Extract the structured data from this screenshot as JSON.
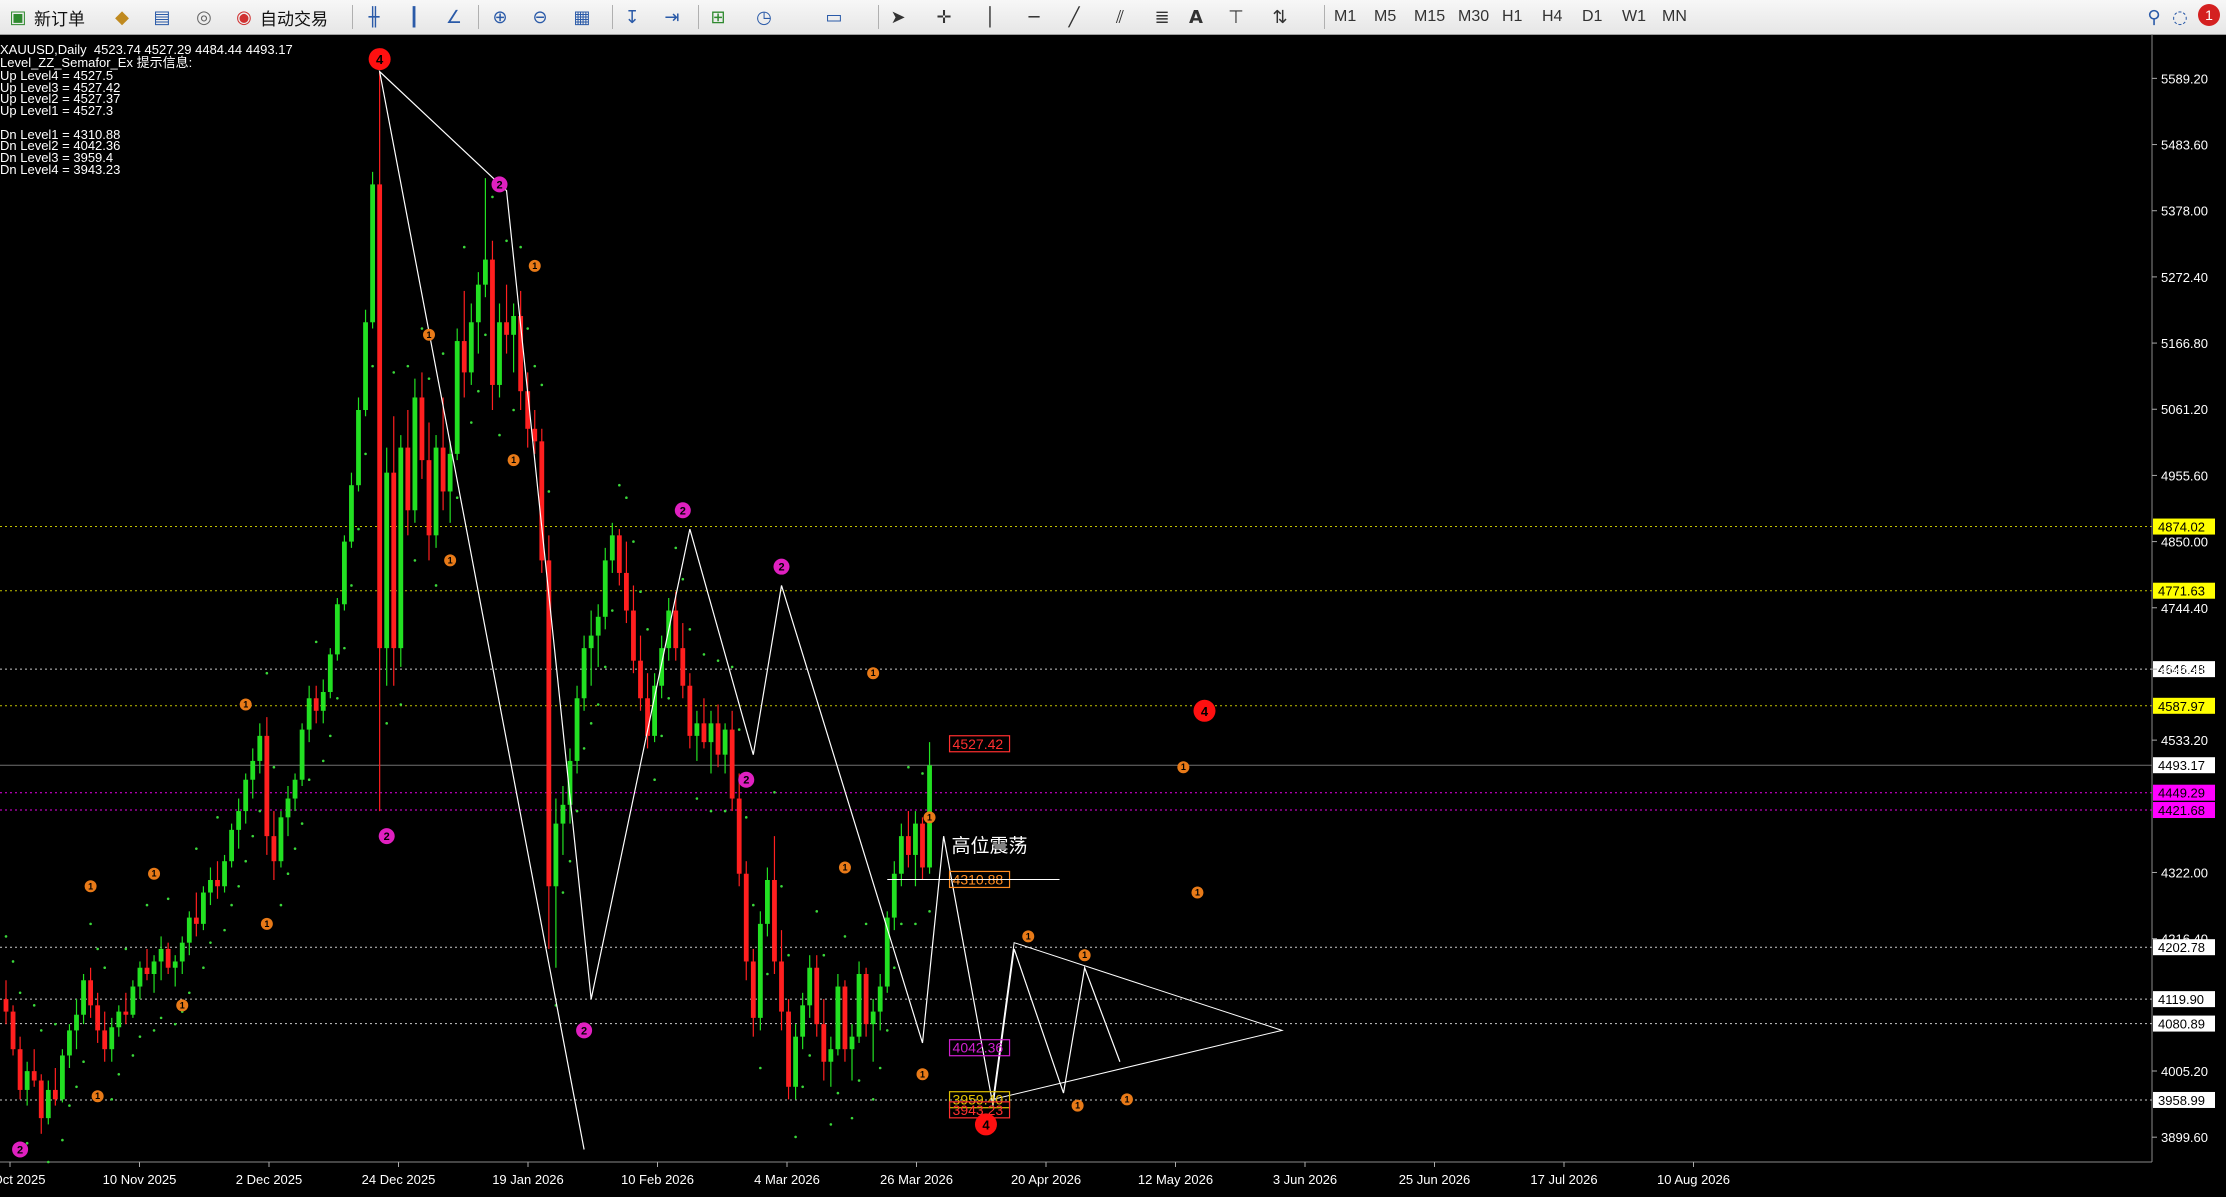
{
  "toolbar": {
    "new_order": "新订单",
    "auto_trading": "自动交易",
    "timeframes": [
      "M1",
      "M5",
      "M15",
      "M30",
      "H1",
      "H4",
      "D1",
      "W1",
      "MN"
    ],
    "notification_count": "1"
  },
  "info": {
    "symbol_line": "XAUUSD,Daily  4523.74 4527.29 4484.44 4493.17",
    "indicator_name": "Level_ZZ_Semafor_Ex 提示信息:",
    "lines": [
      "Up Level4 = 4527.5",
      "Up Level3 = 4527.42",
      "Up Level2 = 4527.37",
      "Up Level1 = 4527.3",
      "",
      "Dn Level1 = 4310.88",
      "Dn Level2 = 4042.36",
      "Dn Level3 = 3959.4",
      "Dn Level4 = 3943.23"
    ]
  },
  "chart_data": {
    "type": "candlestick",
    "symbol": "XAUUSD",
    "timeframe": "Daily",
    "ylim": [
      3860,
      5660
    ],
    "y_ticks": [
      "5589.20",
      "5483.60",
      "5378.00",
      "5272.40",
      "5166.80",
      "5061.20",
      "4955.60",
      "4850.00",
      "4744.40",
      "4646.48",
      "4533.20",
      "4322.00",
      "4216.40",
      "4005.20",
      "3899.60"
    ],
    "x_ticks": [
      "20 Oct 2025",
      "10 Nov 2025",
      "2 Dec 2025",
      "24 Dec 2025",
      "19 Jan 2026",
      "10 Feb 2026",
      "4 Mar 2026",
      "26 Mar 2026",
      "20 Apr 2026",
      "12 May 2026",
      "3 Jun 2026",
      "25 Jun 2026",
      "17 Jul 2026",
      "10 Aug 2026"
    ],
    "candles": [
      [
        4120,
        4150,
        4080,
        4100
      ],
      [
        4100,
        4110,
        4030,
        4040
      ],
      [
        4040,
        4060,
        3960,
        3975
      ],
      [
        3975,
        4020,
        3950,
        4005
      ],
      [
        4005,
        4040,
        3980,
        3990
      ],
      [
        3990,
        4000,
        3905,
        3930
      ],
      [
        3930,
        3990,
        3920,
        3975
      ],
      [
        3975,
        4010,
        3950,
        3960
      ],
      [
        3960,
        4040,
        3955,
        4030
      ],
      [
        4030,
        4080,
        4010,
        4070
      ],
      [
        4070,
        4120,
        4040,
        4095
      ],
      [
        4095,
        4160,
        4080,
        4150
      ],
      [
        4150,
        4170,
        4090,
        4110
      ],
      [
        4110,
        4130,
        4050,
        4070
      ],
      [
        4070,
        4100,
        4020,
        4040
      ],
      [
        4040,
        4090,
        4020,
        4075
      ],
      [
        4075,
        4110,
        4060,
        4100
      ],
      [
        4100,
        4130,
        4080,
        4095
      ],
      [
        4095,
        4150,
        4090,
        4140
      ],
      [
        4140,
        4180,
        4120,
        4170
      ],
      [
        4170,
        4200,
        4150,
        4160
      ],
      [
        4160,
        4190,
        4130,
        4180
      ],
      [
        4180,
        4220,
        4150,
        4200
      ],
      [
        4200,
        4210,
        4160,
        4170
      ],
      [
        4170,
        4190,
        4140,
        4180
      ],
      [
        4180,
        4220,
        4160,
        4210
      ],
      [
        4210,
        4260,
        4190,
        4250
      ],
      [
        4250,
        4290,
        4220,
        4240
      ],
      [
        4240,
        4300,
        4230,
        4290
      ],
      [
        4290,
        4330,
        4270,
        4310
      ],
      [
        4310,
        4340,
        4280,
        4300
      ],
      [
        4300,
        4350,
        4290,
        4340
      ],
      [
        4340,
        4400,
        4330,
        4390
      ],
      [
        4390,
        4440,
        4360,
        4420
      ],
      [
        4420,
        4480,
        4400,
        4470
      ],
      [
        4470,
        4520,
        4440,
        4500
      ],
      [
        4500,
        4560,
        4480,
        4540
      ],
      [
        4540,
        4570,
        4350,
        4380
      ],
      [
        4380,
        4420,
        4310,
        4340
      ],
      [
        4340,
        4420,
        4330,
        4410
      ],
      [
        4410,
        4460,
        4380,
        4440
      ],
      [
        4440,
        4480,
        4420,
        4470
      ],
      [
        4470,
        4560,
        4460,
        4550
      ],
      [
        4550,
        4620,
        4530,
        4600
      ],
      [
        4600,
        4620,
        4560,
        4580
      ],
      [
        4580,
        4630,
        4560,
        4610
      ],
      [
        4610,
        4680,
        4600,
        4670
      ],
      [
        4670,
        4760,
        4660,
        4750
      ],
      [
        4750,
        4860,
        4740,
        4850
      ],
      [
        4850,
        4960,
        4840,
        4940
      ],
      [
        4940,
        5080,
        4930,
        5060
      ],
      [
        5060,
        5220,
        5050,
        5200
      ],
      [
        5200,
        5440,
        5190,
        5420
      ],
      [
        5420,
        5600,
        4420,
        4680
      ],
      [
        4680,
        5000,
        4620,
        4960
      ],
      [
        4960,
        5050,
        4620,
        4680
      ],
      [
        4680,
        5020,
        4650,
        5000
      ],
      [
        5000,
        5060,
        4860,
        4900
      ],
      [
        4900,
        5110,
        4880,
        5080
      ],
      [
        5080,
        5120,
        4950,
        4980
      ],
      [
        4980,
        5040,
        4820,
        4860
      ],
      [
        4860,
        5020,
        4840,
        5000
      ],
      [
        5000,
        5080,
        4900,
        4930
      ],
      [
        4930,
        5010,
        4880,
        4990
      ],
      [
        4990,
        5190,
        4980,
        5170
      ],
      [
        5170,
        5250,
        5080,
        5120
      ],
      [
        5120,
        5230,
        5100,
        5200
      ],
      [
        5200,
        5280,
        5150,
        5260
      ],
      [
        5260,
        5430,
        5240,
        5300
      ],
      [
        5300,
        5330,
        5060,
        5100
      ],
      [
        5100,
        5230,
        5080,
        5200
      ],
      [
        5200,
        5260,
        5150,
        5180
      ],
      [
        5180,
        5230,
        5120,
        5210
      ],
      [
        5210,
        5250,
        5060,
        5090
      ],
      [
        5090,
        5120,
        5000,
        5030
      ],
      [
        5030,
        5060,
        4990,
        5010
      ],
      [
        5010,
        5030,
        4800,
        4820
      ],
      [
        4820,
        4860,
        4200,
        4300
      ],
      [
        4300,
        4440,
        4170,
        4400
      ],
      [
        4400,
        4460,
        4350,
        4430
      ],
      [
        4430,
        4520,
        4400,
        4500
      ],
      [
        4500,
        4620,
        4480,
        4600
      ],
      [
        4600,
        4700,
        4580,
        4680
      ],
      [
        4680,
        4740,
        4620,
        4700
      ],
      [
        4700,
        4750,
        4650,
        4730
      ],
      [
        4730,
        4840,
        4710,
        4820
      ],
      [
        4820,
        4880,
        4800,
        4860
      ],
      [
        4860,
        4870,
        4780,
        4800
      ],
      [
        4800,
        4850,
        4720,
        4740
      ],
      [
        4740,
        4780,
        4640,
        4660
      ],
      [
        4660,
        4700,
        4580,
        4600
      ],
      [
        4600,
        4640,
        4520,
        4540
      ],
      [
        4540,
        4640,
        4530,
        4620
      ],
      [
        4620,
        4700,
        4600,
        4680
      ],
      [
        4680,
        4760,
        4660,
        4740
      ],
      [
        4740,
        4770,
        4660,
        4680
      ],
      [
        4680,
        4720,
        4600,
        4620
      ],
      [
        4620,
        4640,
        4520,
        4540
      ],
      [
        4540,
        4580,
        4500,
        4560
      ],
      [
        4560,
        4600,
        4520,
        4530
      ],
      [
        4530,
        4580,
        4480,
        4560
      ],
      [
        4560,
        4590,
        4490,
        4510
      ],
      [
        4510,
        4560,
        4480,
        4550
      ],
      [
        4550,
        4580,
        4420,
        4440
      ],
      [
        4440,
        4480,
        4300,
        4320
      ],
      [
        4320,
        4340,
        4150,
        4180
      ],
      [
        4180,
        4200,
        4060,
        4090
      ],
      [
        4090,
        4260,
        4070,
        4240
      ],
      [
        4240,
        4330,
        4220,
        4310
      ],
      [
        4310,
        4380,
        4160,
        4180
      ],
      [
        4180,
        4230,
        4070,
        4100
      ],
      [
        4100,
        4120,
        3960,
        3980
      ],
      [
        3980,
        4080,
        3960,
        4060
      ],
      [
        4060,
        4130,
        4040,
        4110
      ],
      [
        4110,
        4190,
        4090,
        4170
      ],
      [
        4170,
        4190,
        4060,
        4080
      ],
      [
        4080,
        4120,
        3990,
        4020
      ],
      [
        4020,
        4060,
        3980,
        4040
      ],
      [
        4040,
        4160,
        4030,
        4140
      ],
      [
        4140,
        4150,
        4020,
        4040
      ],
      [
        4040,
        4080,
        3990,
        4060
      ],
      [
        4060,
        4180,
        4050,
        4160
      ],
      [
        4160,
        4170,
        4060,
        4080
      ],
      [
        4080,
        4120,
        4020,
        4100
      ],
      [
        4100,
        4160,
        4070,
        4140
      ],
      [
        4140,
        4260,
        4130,
        4250
      ],
      [
        4250,
        4340,
        4230,
        4320
      ],
      [
        4320,
        4400,
        4300,
        4380
      ],
      [
        4380,
        4420,
        4330,
        4350
      ],
      [
        4350,
        4420,
        4300,
        4400
      ],
      [
        4400,
        4410,
        4310,
        4330
      ],
      [
        4330,
        4530,
        4320,
        4493
      ]
    ],
    "horizontal_levels": [
      {
        "value": 4874.02,
        "label": "4874.02",
        "style": "dotted",
        "color": "#d8d800",
        "label_bg": "#ffff00"
      },
      {
        "value": 4771.63,
        "label": "4771.63",
        "style": "dotted",
        "color": "#d8d800",
        "label_bg": "#ffff00"
      },
      {
        "value": 4646.48,
        "label": "4646.48",
        "style": "dotted",
        "color": "#e0e0e0",
        "label_bg": "#ffffff"
      },
      {
        "value": 4587.97,
        "label": "4587.97",
        "style": "dotted",
        "color": "#d8d800",
        "label_bg": "#ffff00"
      },
      {
        "value": 4493.17,
        "label": "4493.17",
        "style": "solid",
        "color": "#a0a0a0",
        "label_bg": "#ffffff"
      },
      {
        "value": 4449.29,
        "label": "4449.29",
        "style": "dotted",
        "color": "#ff00ff",
        "label_bg": "#ff00ff"
      },
      {
        "value": 4421.68,
        "label": "4421.68",
        "style": "dotted",
        "color": "#ff00ff",
        "label_bg": "#ff00ff"
      },
      {
        "value": 4202.78,
        "label": "4202.78",
        "style": "dotted",
        "color": "#e0e0e0",
        "label_bg": "#ffffff"
      },
      {
        "value": 4119.9,
        "label": "4119.90",
        "style": "dotted",
        "color": "#e0e0e0",
        "label_bg": "#ffffff"
      },
      {
        "value": 4080.89,
        "label": "4080.89",
        "style": "dotted",
        "color": "#e0e0e0",
        "label_bg": "#ffffff"
      },
      {
        "value": 3958.99,
        "label": "3958.99",
        "style": "dotted",
        "color": "#e0e0e0",
        "label_bg": "#ffffff"
      }
    ],
    "level_tags": [
      {
        "value": 4527.42,
        "label": "4527.42",
        "color": "#ff3030"
      },
      {
        "value": 4310.88,
        "label": "4310.88",
        "color": "#ff8c20"
      },
      {
        "value": 4042.36,
        "label": "4042.36",
        "color": "#d020d0"
      },
      {
        "value": 3959.4,
        "label": "3959.40",
        "color": "#e0c000"
      },
      {
        "value": 3943.23,
        "label": "3943.23",
        "color": "#ff3030"
      }
    ],
    "annotation": {
      "text": "高位震荡",
      "value": 4355
    },
    "zigzag": [
      [
        82,
        3880
      ],
      [
        53,
        5600
      ],
      [
        71,
        5410
      ],
      [
        83,
        4120
      ],
      [
        97,
        4870
      ],
      [
        106,
        4510
      ],
      [
        110,
        4780
      ],
      [
        130,
        4050
      ],
      [
        133,
        4380
      ],
      [
        140,
        3950
      ],
      [
        143,
        4200
      ],
      [
        150,
        3970
      ],
      [
        153,
        4170
      ],
      [
        158,
        4020
      ]
    ],
    "triangle": [
      [
        143,
        4210
      ],
      [
        181,
        4070
      ],
      [
        140,
        3960
      ]
    ],
    "semafor": [
      {
        "i": 53,
        "v": 5620,
        "level": "4"
      },
      {
        "i": 54,
        "v": 4380,
        "level": "2"
      },
      {
        "i": 70,
        "v": 5420,
        "level": "2"
      },
      {
        "i": 82,
        "v": 4070,
        "level": "2"
      },
      {
        "i": 96,
        "v": 4900,
        "level": "2"
      },
      {
        "i": 105,
        "v": 4470,
        "level": "2"
      },
      {
        "i": 110,
        "v": 4810,
        "level": "2"
      },
      {
        "i": 2,
        "v": 3880,
        "level": "2"
      },
      {
        "i": 139,
        "v": 3920,
        "level": "4"
      },
      {
        "i": 170,
        "v": 4580,
        "level": "4"
      },
      {
        "i": 34,
        "v": 4590,
        "level": "1"
      },
      {
        "i": 37,
        "v": 4240,
        "level": "1"
      },
      {
        "i": 12,
        "v": 4300,
        "level": "1"
      },
      {
        "i": 13,
        "v": 3965,
        "level": "1"
      },
      {
        "i": 21,
        "v": 4320,
        "level": "1"
      },
      {
        "i": 25,
        "v": 4110,
        "level": "1"
      },
      {
        "i": 60,
        "v": 5180,
        "level": "1"
      },
      {
        "i": 63,
        "v": 4820,
        "level": "1"
      },
      {
        "i": 72,
        "v": 4980,
        "level": "1"
      },
      {
        "i": 75,
        "v": 5290,
        "level": "1"
      },
      {
        "i": 123,
        "v": 4640,
        "level": "1"
      },
      {
        "i": 119,
        "v": 4330,
        "level": "1"
      },
      {
        "i": 131,
        "v": 4410,
        "level": "1"
      },
      {
        "i": 130,
        "v": 4000,
        "level": "1"
      },
      {
        "i": 145,
        "v": 4220,
        "level": "1"
      },
      {
        "i": 153,
        "v": 4190,
        "level": "1"
      },
      {
        "i": 152,
        "v": 3950,
        "level": "1"
      },
      {
        "i": 159,
        "v": 3960,
        "level": "1"
      },
      {
        "i": 167,
        "v": 4490,
        "level": "1"
      },
      {
        "i": 169,
        "v": 4290,
        "level": "1"
      }
    ]
  }
}
